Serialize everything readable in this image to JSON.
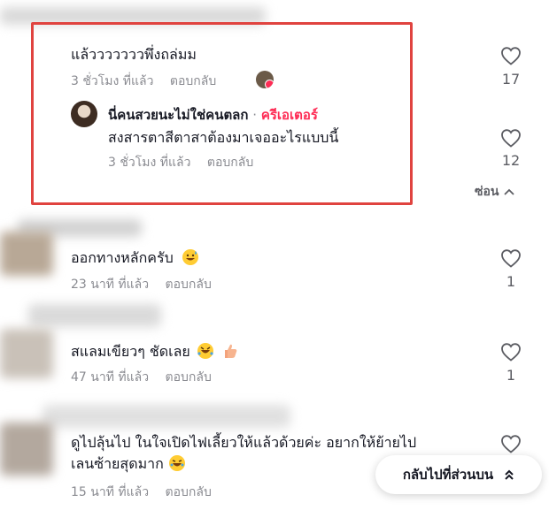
{
  "comments": [
    {
      "text": "แล้วววววววพึ่งถล่มม",
      "time": "3 ชั่วโมง ที่แล้ว",
      "reply": "ตอบกลับ",
      "likes": "17",
      "replies": [
        {
          "author": "นี่คนสวยนะไม่ใช่คนตลก",
          "separator": "·",
          "badge": "ครีเอเตอร์",
          "text": "สงสารตาสีตาสาต้องมาเจออะไรแบบนี้",
          "time": "3 ชั่วโมง ที่แล้ว",
          "reply": "ตอบกลับ",
          "likes": "12"
        }
      ],
      "collapse_label": "ซ่อน"
    },
    {
      "text": "ออกทางหลักครับ",
      "time": "23 นาที ที่แล้ว",
      "reply": "ตอบกลับ",
      "likes": "1"
    },
    {
      "text": "สแลมเขียวๆ ชัดเลย",
      "time": "47 นาที ที่แล้ว",
      "reply": "ตอบกลับ",
      "likes": "1"
    },
    {
      "text_line1": "ดูไปลุ้นไป ในใจเปิดไฟเลี้ยวให้แล้วด้วยค่ะ อยากให้ย้ายไป",
      "text_line2": "เลนซ้ายสุดมาก",
      "time": "15 นาที ที่แล้ว",
      "reply": "ตอบกลับ"
    }
  ],
  "back_to_top": "กลับไปที่ส่วนบน",
  "colors": {
    "highlight": "#e0433f",
    "creator": "#fe2c55",
    "meta": "#8a8b91"
  }
}
